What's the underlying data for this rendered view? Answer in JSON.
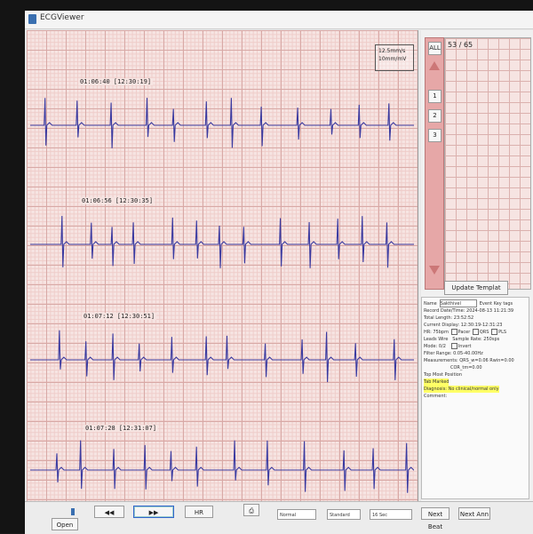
{
  "window": {
    "title": "ECGViewer"
  },
  "ecg": {
    "scale_speed": "12.5mm/s",
    "scale_gain": "10mm/mV",
    "strips": [
      {
        "time": "01:06:40 [12:30:19]"
      },
      {
        "time": "01:06:56 [12:30:35]"
      },
      {
        "time": "01:07:12 [12:30:51]"
      },
      {
        "time": "01:07:28 [12:31:07]"
      }
    ]
  },
  "sidebar": {
    "all_label": "ALL",
    "page_counter": "53 / 65",
    "thumbs": [
      "1",
      "2",
      "3"
    ],
    "update_label": "Update Templat"
  },
  "info": {
    "name_label": "Name",
    "name_value": "Sakthivel",
    "class_label": "Event",
    "class_value": "Key tags",
    "record_line": "Record Date/Time: 2024-08-13 11:21:39",
    "total_line": "Total Length: 23:52:52",
    "current_line": "Current Display: 12:30:19-12:31:23",
    "hr_line": "HR: 75bpm",
    "pacer_label": "Pacer",
    "qrs_label": "QRS",
    "pls_label": "PLS",
    "lead_line": "Leads Wire",
    "sample_line": "Sample Rate: 250sps",
    "mode_line": "Mode: 0/2",
    "invert_label": "Invert",
    "filter_line": "Filter Range: 0.05-40.00Hz",
    "measure_line": "Measurements: QRS_w=0.06 Rwin=0.00",
    "cor_line": "COR_tm=0.00",
    "top_line": "Top Most Position",
    "evt_line": "Tab Marked",
    "diag_line": "Diagnosis: No clinical/normal only",
    "comment_line": "Comment:"
  },
  "toolbar": {
    "open_label": "Open",
    "prev_label": "◀◀",
    "next_label": "▶▶",
    "hr_label": "HR",
    "print_glyph": "⎙",
    "dd1": "Normal",
    "dd2": "Standard",
    "dd3": "16 Sec",
    "btn_a": "Next Beat",
    "btn_b": "Next Ann"
  },
  "colors": {
    "trace": "#3a3aa0",
    "grid": "#d8a9a6",
    "paper": "#f6e4e2"
  }
}
